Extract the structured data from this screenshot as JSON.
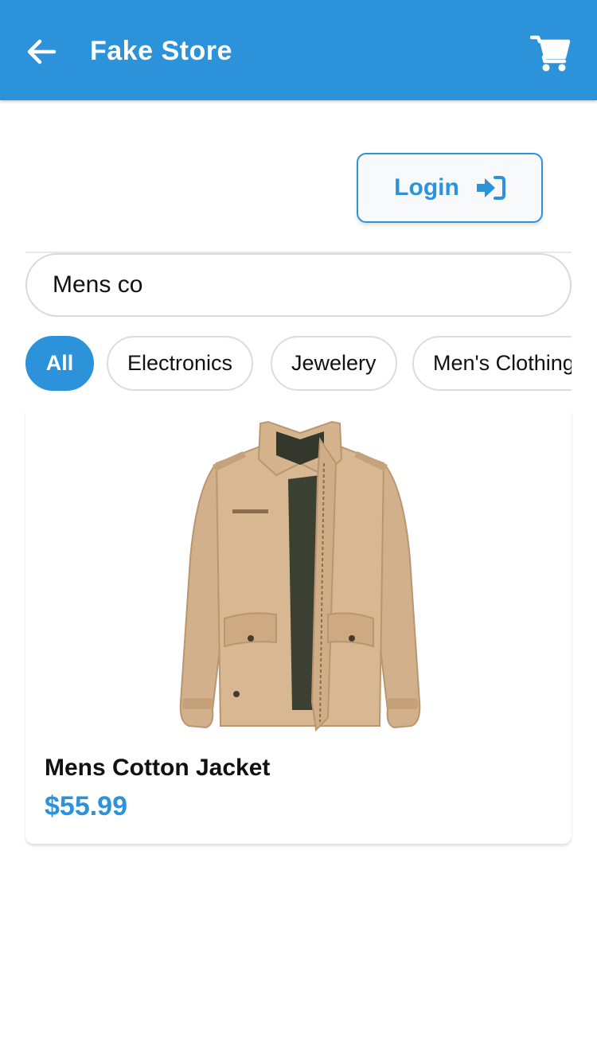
{
  "appbar": {
    "title": "Fake Store",
    "back_icon": "arrow-left-icon",
    "cart_icon": "shopping-cart-icon",
    "color": "#2c93db"
  },
  "login": {
    "label": "Login",
    "icon": "sign-in-icon"
  },
  "search": {
    "value": "Mens co",
    "placeholder": ""
  },
  "categories": [
    {
      "label": "All",
      "active": true
    },
    {
      "label": "Electronics",
      "active": false
    },
    {
      "label": "Jewelery",
      "active": false
    },
    {
      "label": "Men's Clothing",
      "active": false
    }
  ],
  "products": [
    {
      "name": "Mens Cotton Jacket",
      "price": "$55.99"
    }
  ]
}
